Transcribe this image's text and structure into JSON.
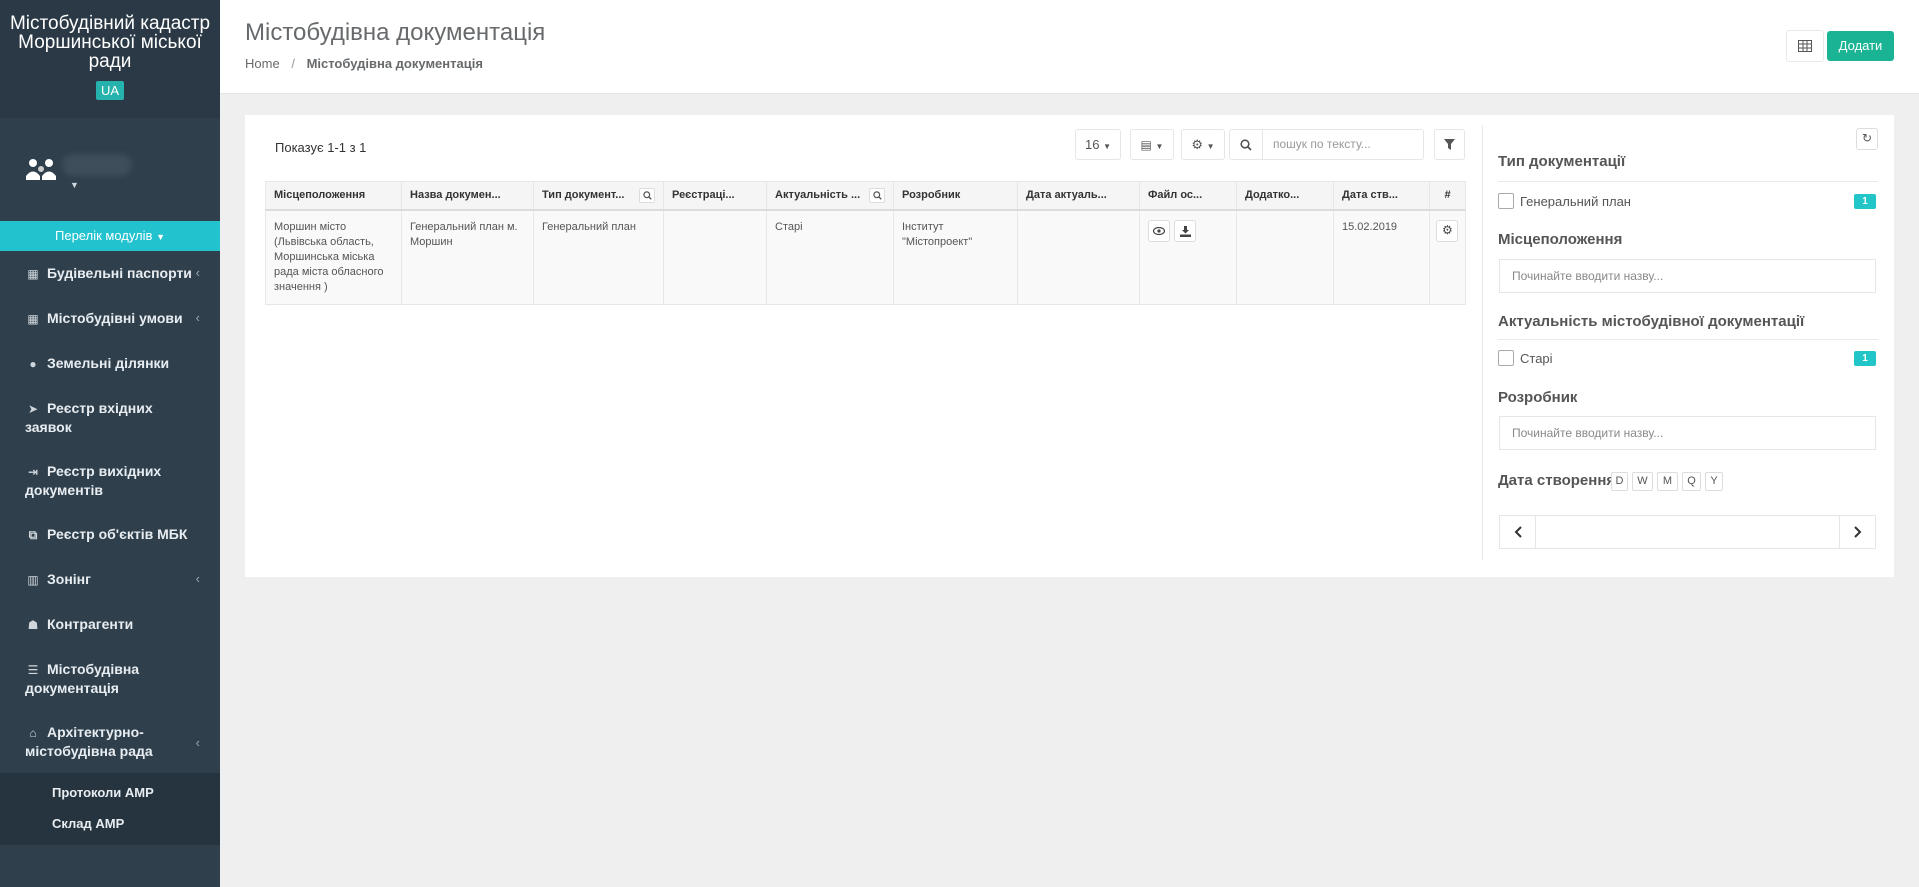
{
  "sidebar": {
    "brand_title": "Містобудівний кадастр Моршинської міської ради",
    "lang": "UA",
    "modules_label": "Перелік модулів",
    "items": [
      {
        "label": "Будівельні паспорти",
        "icon": "building-icon",
        "has_children": true
      },
      {
        "label": "Містобудівні умови",
        "icon": "building-icon",
        "has_children": true
      },
      {
        "label": "Земельні ділянки",
        "icon": "globe-icon",
        "has_children": false
      },
      {
        "label": "Реєстр вхідних заявок",
        "icon": "paper-plane-icon",
        "has_children": false
      },
      {
        "label": "Реєстр вихідних документів",
        "icon": "sign-out-icon",
        "has_children": false
      },
      {
        "label": "Реєстр об'єктів МБК",
        "icon": "object-group-icon",
        "has_children": false
      },
      {
        "label": "Зонінг",
        "icon": "map-icon",
        "has_children": true
      },
      {
        "label": "Контрагенти",
        "icon": "users-icon",
        "has_children": false
      },
      {
        "label": "Містобудівна документація",
        "icon": "list-icon",
        "has_children": false
      },
      {
        "label": "Архітектурно-містобудівна рада",
        "icon": "institution-icon",
        "has_children": true
      }
    ],
    "submenu": [
      "Протоколи АМР",
      "Склад АМР"
    ]
  },
  "header": {
    "title": "Містобудівна документація",
    "breadcrumb_home": "Home",
    "breadcrumb_sep": "/",
    "breadcrumb_current": "Містобудівна документація",
    "add_label": "Додати"
  },
  "toolbar": {
    "shown": "Показує 1-1 з 1",
    "page_size": "16",
    "search_placeholder": "пошук по тексту..."
  },
  "table": {
    "columns": [
      "Місцеположення",
      "Назва докумен...",
      "Тип документ...",
      "Реєстраці...",
      "Актуальність ...",
      "Розробник",
      "Дата актуаль...",
      "Файл ос...",
      "Додатко...",
      "Дата ств...",
      "#"
    ],
    "rows": [
      {
        "location": "Моршин місто (Львівська область, Моршинська міська рада міста обласного значення )",
        "name": "Генеральний план м. Моршин",
        "type": "Генеральний план",
        "registration": "",
        "relevance": "Старі",
        "developer": "Інститут \"Містопроект\"",
        "relevance_date": "",
        "extra": "",
        "created": "15.02.2019"
      }
    ]
  },
  "filters": {
    "doc_type_title": "Тип документації",
    "doc_type_option": "Генеральний план",
    "doc_type_count": "1",
    "location_title": "Місцеположення",
    "location_placeholder": "Починайте вводити назву...",
    "relevance_title": "Актуальність містобудівної документації",
    "relevance_option": "Старі",
    "relevance_count": "1",
    "developer_title": "Розробник",
    "developer_placeholder": "Починайте вводити назву...",
    "created_title": "Дата створення",
    "periods": [
      "D",
      "W",
      "M",
      "Q",
      "Y"
    ]
  },
  "colors": {
    "sidebar_bg": "#2f3f4c",
    "accent_cyan": "#22c2cf",
    "add_green": "#1ab394",
    "badge_teal": "#23c6c8"
  }
}
